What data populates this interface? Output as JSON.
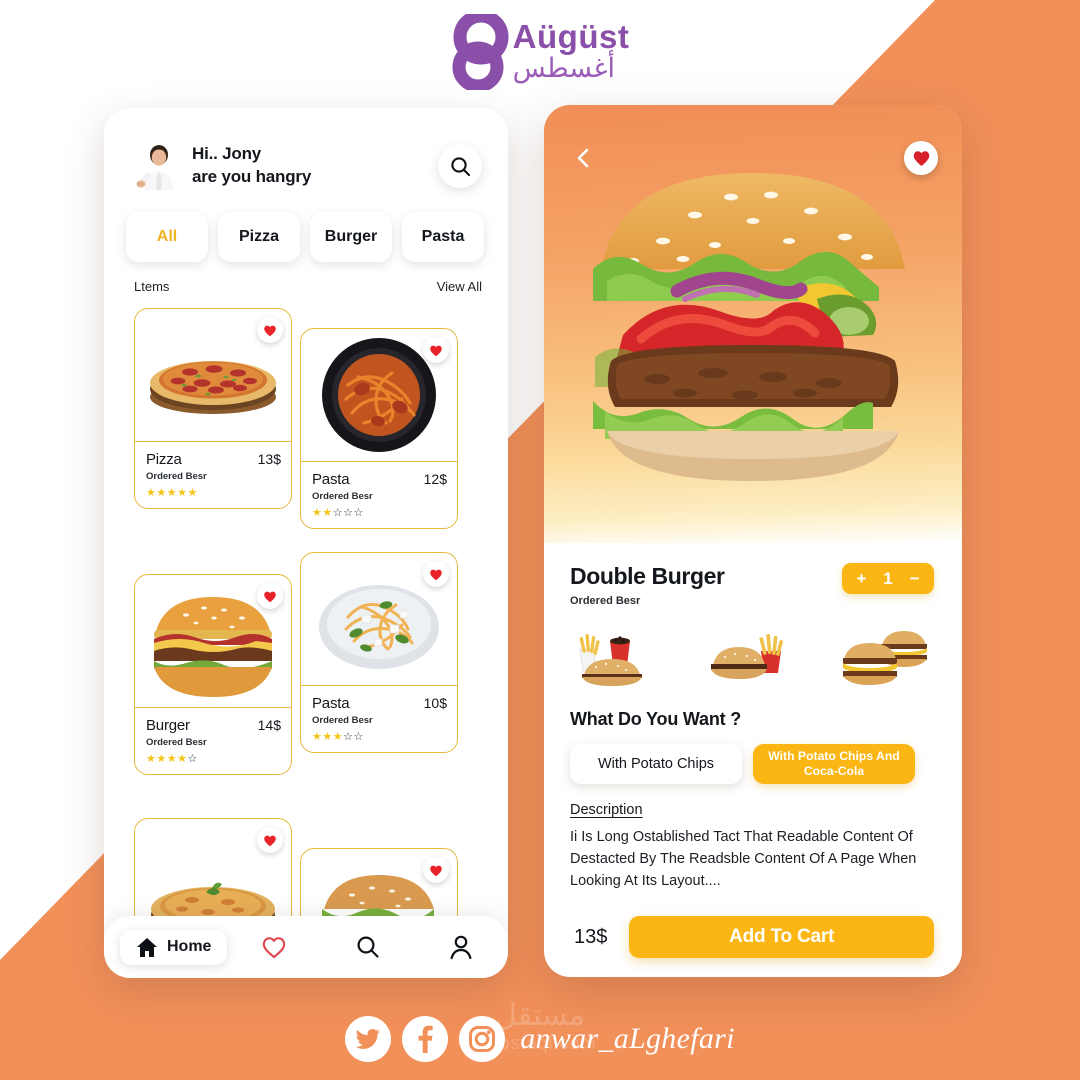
{
  "brand": {
    "name_en": "Aügüst",
    "name_ar": "أغسطس",
    "color": "#8a4fa8"
  },
  "theme": {
    "background_orange": "#f08e56",
    "accent_yellow": "#fbb614",
    "card_border": "#e8b93f",
    "star_on": "#f5c518",
    "heart_red": "#e8242a"
  },
  "list_screen": {
    "greeting_line1": "Hi.. Jony",
    "greeting_line2": "are you hangry",
    "avatar_icon": "user-photo",
    "search_icon": "search-icon",
    "categories": [
      {
        "label": "All",
        "active": true
      },
      {
        "label": "Pizza",
        "active": false
      },
      {
        "label": "Burger",
        "active": false
      },
      {
        "label": "Pasta",
        "active": false
      }
    ],
    "section_title": "Ltems",
    "view_all": "View All",
    "items": [
      {
        "name": "Pizza",
        "price": "13$",
        "subtitle": "Ordered Besr",
        "rating": 5,
        "max_rating": 5,
        "image": "pizza-pepperoni",
        "favorite": true
      },
      {
        "name": "Pasta",
        "price": "12$",
        "subtitle": "Ordered Besr",
        "rating": 2,
        "max_rating": 5,
        "image": "pasta-black-pan",
        "favorite": true
      },
      {
        "name": "Burger",
        "price": "14$",
        "subtitle": "Ordered Besr",
        "rating": 4,
        "max_rating": 5,
        "image": "burger-bacon",
        "favorite": true
      },
      {
        "name": "Pasta",
        "price": "10$",
        "subtitle": "Ordered Besr",
        "rating": 3,
        "max_rating": 5,
        "image": "pasta-white-plate",
        "favorite": true
      },
      {
        "name": "",
        "price": "",
        "subtitle": "",
        "rating": 0,
        "max_rating": 5,
        "image": "pizza-cheese",
        "favorite": true
      },
      {
        "name": "",
        "price": "",
        "subtitle": "",
        "rating": 0,
        "max_rating": 5,
        "image": "burger-veggie",
        "favorite": true
      }
    ],
    "tabbar": {
      "home_label": "Home",
      "home_icon": "home-icon",
      "favorites_icon": "heart-icon",
      "search_icon": "search-icon",
      "profile_icon": "person-icon"
    }
  },
  "detail_screen": {
    "back_icon": "chevron-left-icon",
    "favorite_icon": "heart-icon",
    "hero_image": "double-burger-large",
    "title": "Double Burger",
    "subtitle": "Ordered Besr",
    "quantity": "1",
    "increase_label": "+",
    "decrease_label": "−",
    "thumbnails": [
      {
        "image": "burger-fries-cola"
      },
      {
        "image": "burger-fries"
      },
      {
        "image": "double-cheeseburgers"
      }
    ],
    "question": "What Do You Want ?",
    "options": [
      {
        "label": "With Potato Chips",
        "selected": false
      },
      {
        "label": "With Potato Chips And Coca-Cola",
        "selected": true
      }
    ],
    "description_label": "Description",
    "description_text": "Ii Is Long Ostablished Tact That Readable Content Of Destacted By The Readsble Content Of A Page When Looking At Its Layout....",
    "price": "13$",
    "add_to_cart": "Add To Cart"
  },
  "footer": {
    "socials": [
      {
        "name": "twitter-icon"
      },
      {
        "name": "facebook-icon"
      },
      {
        "name": "instagram-icon"
      }
    ],
    "handle": "anwar_aLghefari",
    "watermark_ar": "مستقل",
    "watermark_en": "mostaql.com"
  }
}
